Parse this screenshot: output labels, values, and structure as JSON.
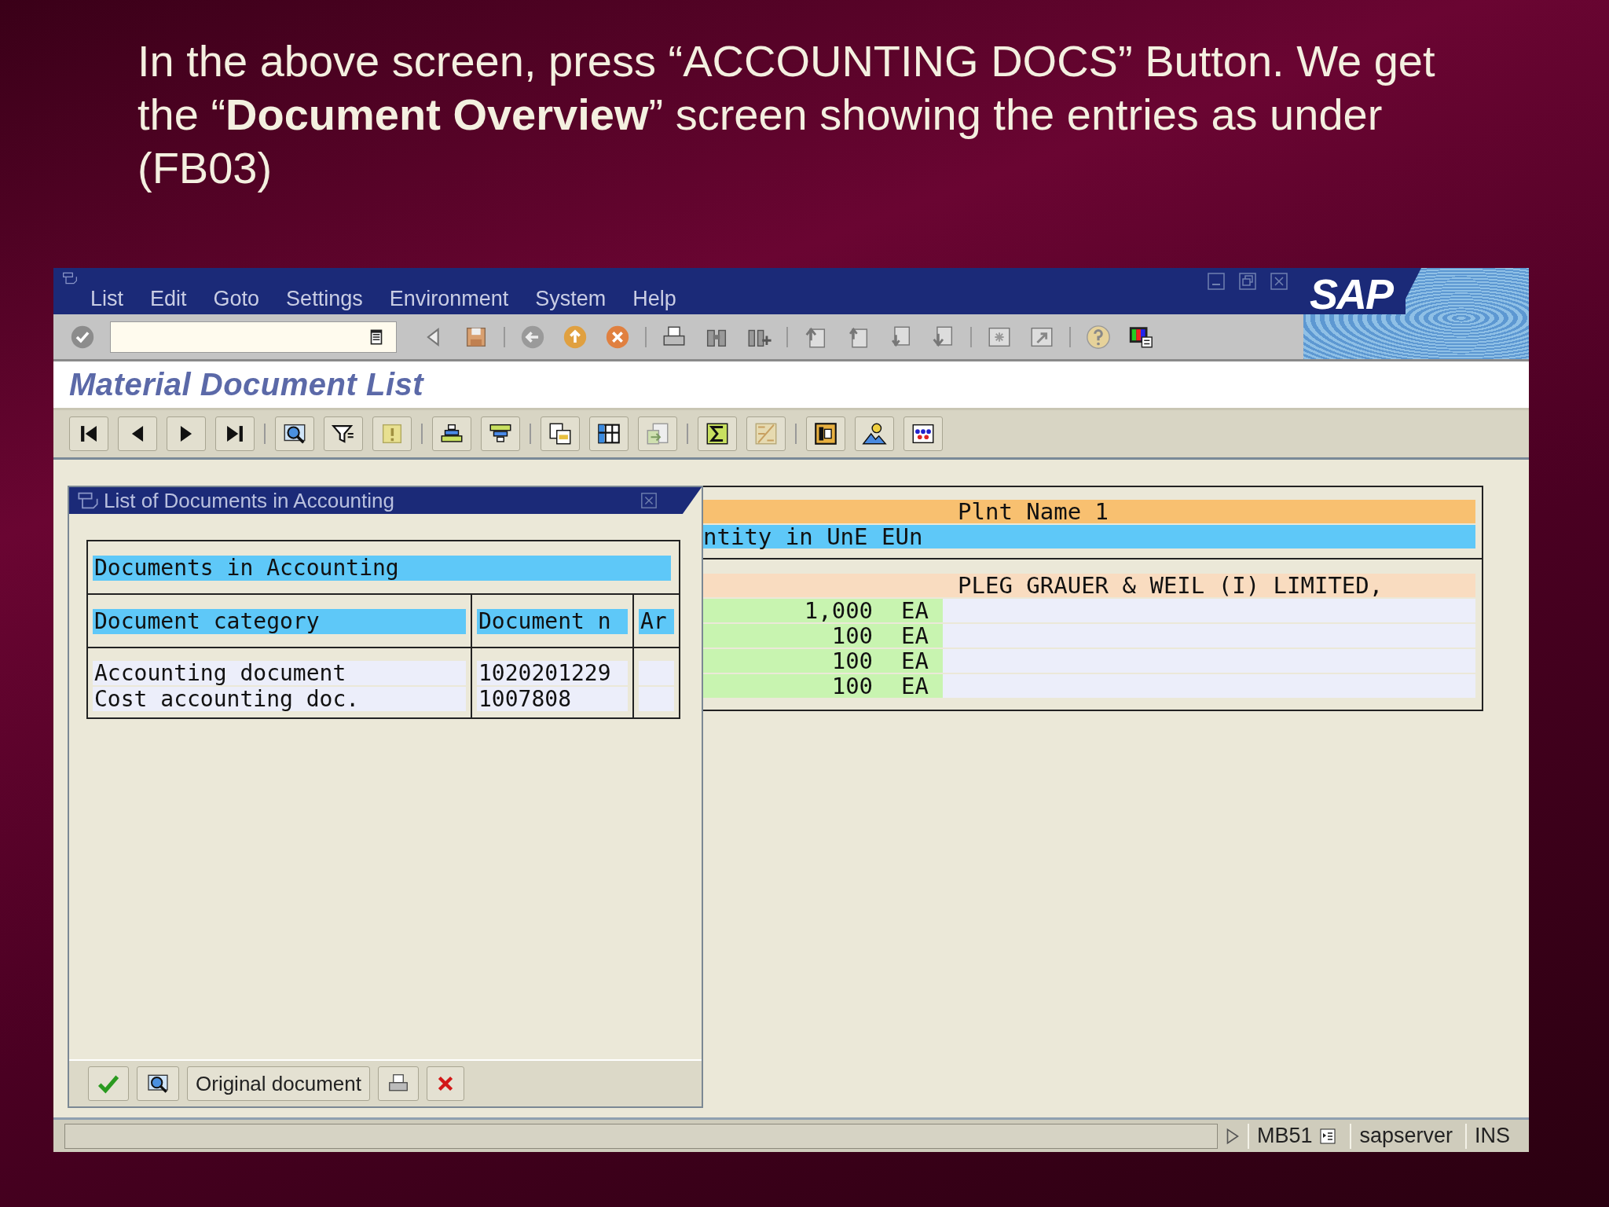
{
  "caption": "In the above screen, press “ACCOUNTING DOCS” Button. We get the “**Document Overview**” screen showing the entries as under (FB03)",
  "window": {
    "menu": [
      "List",
      "Edit",
      "Goto",
      "Settings",
      "Environment",
      "System",
      "Help"
    ],
    "logo": "SAP",
    "title": "Material Document List"
  },
  "dialog": {
    "title": "List of Documents in Accounting",
    "table_title": "Documents in Accounting",
    "columns": [
      "Document category",
      "Document n",
      "Ar"
    ],
    "rows": [
      {
        "category": "Accounting document",
        "number": "1020201229"
      },
      {
        "category": "Cost accounting doc.",
        "number": "1007808"
      }
    ],
    "button_label": "Original document"
  },
  "list": {
    "plant_header": "Plnt Name 1",
    "quantity_header": "ntity in UnE EUn",
    "vendor_row": "PLEG GRAUER & WEIL (I) LIMITED,",
    "rows": [
      {
        "quantity": "1,000",
        "unit": "EA"
      },
      {
        "quantity": "100",
        "unit": "EA"
      },
      {
        "quantity": "100",
        "unit": "EA"
      },
      {
        "quantity": "100",
        "unit": "EA"
      }
    ]
  },
  "status_bar": {
    "transaction": "MB51",
    "server": "sapserver",
    "mode": "INS"
  }
}
